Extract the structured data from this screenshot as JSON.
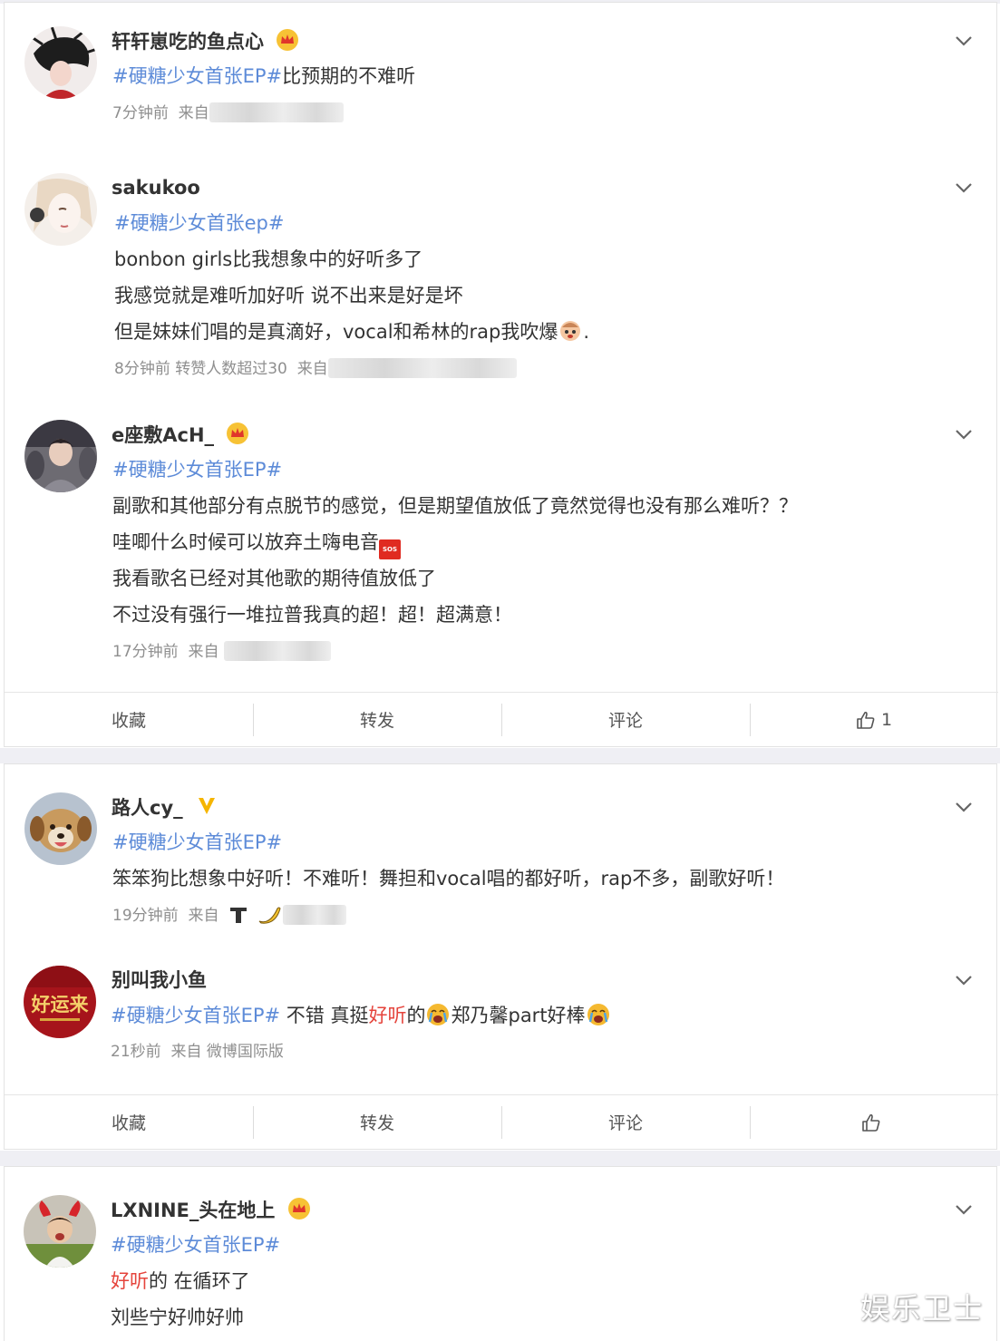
{
  "posts": [
    {
      "username": "轩轩崽吃的鱼点心",
      "tag": "#硬糖少女首张EP#",
      "text": "比预期的不难听",
      "time": "7分钟前",
      "from_label": "来自"
    },
    {
      "username": "sakukoo",
      "tag": "#硬糖少女首张ep#",
      "lines": [
        "bonbon girls比我想象中的好听多了",
        "我感觉就是难听加好听 说不出来是好是坏",
        "但是妹妹们唱的是真滴好，vocal和希林的rap我吹爆",
        "."
      ],
      "time": "8分钟前",
      "extra": "转赞人数超过30",
      "from_label": "来自"
    },
    {
      "username": "e座敷AcH_",
      "tag": "#硬糖少女首张EP#",
      "lines": [
        "副歌和其他部分有点脱节的感觉，但是期望值放低了竟然觉得也没有那么难听？？",
        "哇唧什么时候可以放弃土嗨电音",
        "我看歌名已经对其他歌的期待值放低了",
        "不过没有强行一堆拉普我真的超！超！超满意！"
      ],
      "sos": "SOS",
      "time": "17分钟前",
      "from_label": "来自"
    },
    {
      "username": "路人cy_",
      "tag": "#硬糖少女首张EP#",
      "text": "笨笨狗比想象中好听！不难听！舞担和vocal唱的都好听，rap不多，副歌好听！",
      "time": "19分钟前",
      "from_label": "来自"
    },
    {
      "username": "别叫我小鱼",
      "tag": "#硬糖少女首张EP#",
      "seg1": " 不错 真挺",
      "seg2": "好听",
      "seg3": "的",
      "seg4": "郑乃馨part好棒",
      "avatar_text": "好运来",
      "time": "21秒前",
      "from_label": "来自",
      "client": "微博国际版"
    },
    {
      "username": "LXNINE_头在地上",
      "tag": "#硬糖少女首张EP#",
      "seg_red": "好听",
      "seg_rest": "的 在循环了",
      "line3": "刘些宁好帅好帅"
    }
  ],
  "actions1": {
    "fav": "收藏",
    "repost": "转发",
    "comment": "评论",
    "likes": "1"
  },
  "actions2": {
    "fav": "收藏",
    "repost": "转发",
    "comment": "评论",
    "likes": ""
  },
  "watermark": "娱乐卫士",
  "colors": {
    "tag": "#5d8bd8",
    "red": "#e5443c",
    "meta": "#8f8f8f",
    "separator": "#efeff4"
  }
}
